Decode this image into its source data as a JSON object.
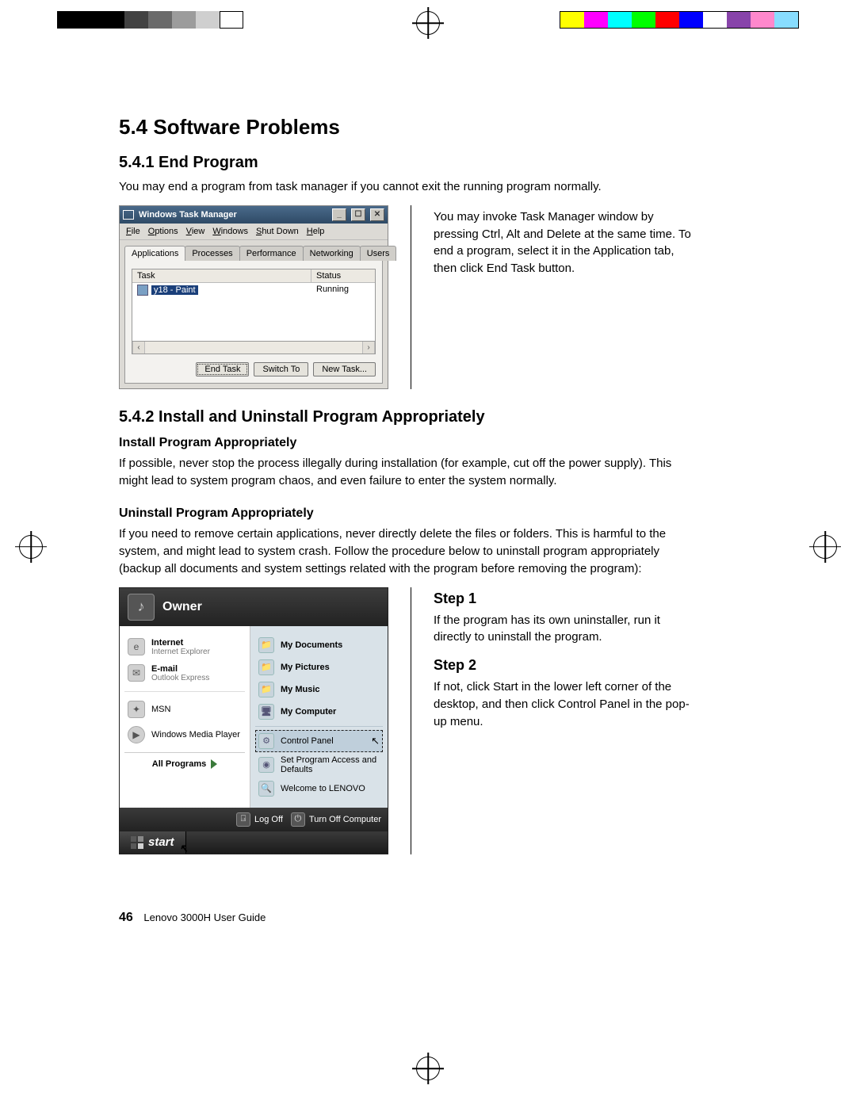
{
  "calibration_colors_right": [
    "#ffff00",
    "#ff00ff",
    "#00ffff",
    "#00ff00",
    "#ff0000",
    "#0000ff",
    "#ffffff",
    "#8844aa",
    "#ff88cc",
    "#88ddff"
  ],
  "section": {
    "title": "5.4 Software Problems",
    "s1": {
      "title": "5.4.1 End Program",
      "intro": "You may end a program from task manager if you cannot exit the running program normally.",
      "side": "You may invoke Task Manager window by pressing Ctrl, Alt and Delete at the same time. To end a program, select it in the Application tab, then click End Task button."
    },
    "s2": {
      "title": "5.4.2 Install and Uninstall Program Appropriately",
      "h1": "Install Program Appropriately",
      "p1": "If possible, never stop the process illegally during installation (for example, cut off the power supply). This might lead to system program chaos, and even failure to enter the system normally.",
      "h2": "Uninstall Program Appropriately",
      "p2": "If you need to remove certain applications, never directly delete the files or folders. This is harmful to the system, and might lead to system crash. Follow the procedure below to uninstall program appropriately (backup all documents and system settings related with the program before removing the program):",
      "step1_h": "Step 1",
      "step1_p": "If the program has its own uninstaller, run it directly to uninstall the program.",
      "step2_h": "Step 2",
      "step2_p": "If not, click Start in the lower left corner of the desktop, and then click Control Panel in the pop-up menu."
    }
  },
  "task_manager": {
    "title": "Windows Task Manager",
    "menus": [
      "File",
      "Options",
      "View",
      "Windows",
      "Shut Down",
      "Help"
    ],
    "tabs": [
      "Applications",
      "Processes",
      "Performance",
      "Networking",
      "Users"
    ],
    "active_tab": 0,
    "columns": [
      "Task",
      "Status"
    ],
    "rows": [
      {
        "icon": "paint-icon",
        "name": "y18 - Paint",
        "status": "Running",
        "selected": true
      }
    ],
    "buttons": {
      "end_task": "End Task",
      "switch_to": "Switch To",
      "new_task": "New Task..."
    },
    "window_buttons": [
      "minimize",
      "maximize",
      "close"
    ]
  },
  "start_menu": {
    "user": "Owner",
    "left_pinned": [
      {
        "icon": "ie-icon",
        "title": "Internet",
        "subtitle": "Internet Explorer"
      },
      {
        "icon": "mail-icon",
        "title": "E-mail",
        "subtitle": "Outlook Express"
      }
    ],
    "left_items": [
      {
        "icon": "msn-icon",
        "label": "MSN"
      },
      {
        "icon": "wmp-icon",
        "label": "Windows Media Player"
      }
    ],
    "all_programs": "All Programs",
    "right_items": [
      {
        "icon": "folder-icon",
        "label": "My Documents",
        "bold": true
      },
      {
        "icon": "folder-icon",
        "label": "My Pictures",
        "bold": true
      },
      {
        "icon": "folder-icon",
        "label": "My Music",
        "bold": true
      },
      {
        "icon": "computer-icon",
        "label": "My Computer",
        "bold": true
      },
      {
        "icon": "control-panel-icon",
        "label": "Control Panel",
        "bold": false,
        "highlight": true
      },
      {
        "icon": "access-icon",
        "label": "Set Program Access and Defaults",
        "bold": false
      },
      {
        "icon": "search-icon",
        "label": "Welcome to LENOVO",
        "bold": false
      }
    ],
    "bottom": {
      "logoff": "Log Off",
      "turnoff": "Turn Off Computer"
    },
    "taskbar": {
      "start": "start"
    }
  },
  "footer": {
    "page": "46",
    "book": "Lenovo 3000H User Guide"
  }
}
